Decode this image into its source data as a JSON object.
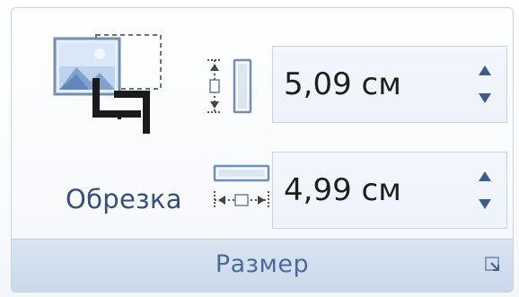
{
  "group": {
    "title": "Размер",
    "launcher_icon": "dialog-launcher-icon"
  },
  "crop": {
    "label": "Обрезка",
    "icon": "crop-picture-icon"
  },
  "height": {
    "value": "5,09 см",
    "icon": "shape-height-icon"
  },
  "width": {
    "value": "4,99 см",
    "icon": "shape-width-icon"
  },
  "colors": {
    "label_blue": "#2f4f86",
    "footer_bg": "#d3dfee",
    "field_border": "#c6d4e6"
  }
}
